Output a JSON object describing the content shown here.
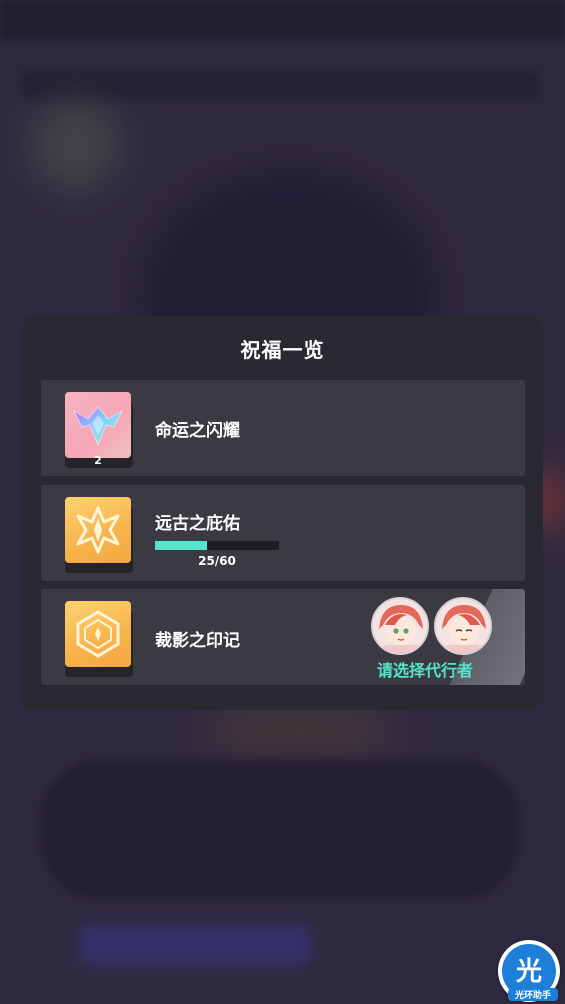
{
  "dialog": {
    "title": "祝福一览",
    "items": [
      {
        "icon": "fate-crest-icon",
        "name": "命运之闪耀",
        "count": "2"
      },
      {
        "icon": "ancient-shield-icon",
        "name": "远古之庇佑",
        "progress_value": 25,
        "progress_max": 60,
        "progress_text": "25/60"
      },
      {
        "icon": "judgement-seal-icon",
        "name": "裁影之印记",
        "action_text": "请选择代行者"
      }
    ]
  },
  "watermark": {
    "glyph": "光",
    "label": "光环助手"
  },
  "colors": {
    "accent": "#56e5cc",
    "dialog_bg": "#2a2830",
    "item_bg": "#3b3a42"
  }
}
